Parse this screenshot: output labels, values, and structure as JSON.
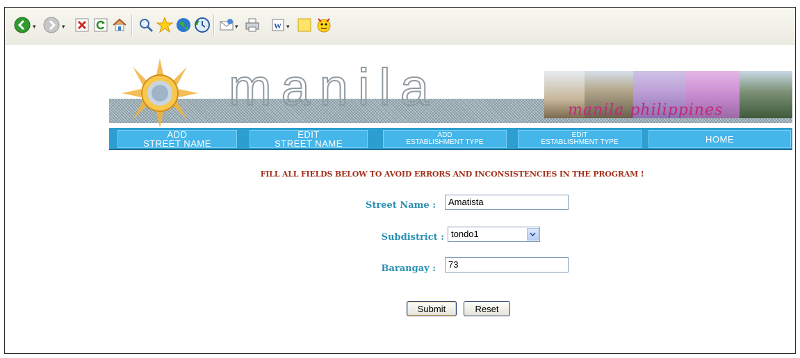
{
  "toolbar": {
    "icons": [
      "back-icon",
      "forward-icon",
      "stop-icon",
      "refresh-icon",
      "home-icon",
      "search-icon",
      "favorites-icon",
      "media-icon",
      "history-icon",
      "mail-icon",
      "print-icon",
      "edit-word-icon",
      "notes-icon",
      "messenger-icon"
    ]
  },
  "banner": {
    "title": "manila",
    "subtitle": "manila philippines"
  },
  "nav": {
    "add_street": [
      "ADD",
      "STREET NAME"
    ],
    "edit_street": [
      "EDIT",
      "STREET NAME"
    ],
    "add_establishment": [
      "ADD",
      "ESTABLISHMENT TYPE"
    ],
    "edit_establishment": [
      "EDIT",
      "ESTABLISHMENT TYPE"
    ],
    "home": "HOME"
  },
  "form": {
    "notice": "FILL ALL FIELDS BELOW TO AVOID ERRORS AND INCONSISTENCIES IN THE PROGRAM !",
    "street_label": "Street Name :",
    "street_value": "Amatista",
    "subdistrict_label": "Subdistrict :",
    "subdistrict_value": "tondo1",
    "barangay_label": "Barangay :",
    "barangay_value": "73",
    "submit_label": "Submit",
    "reset_label": "Reset"
  },
  "colors": {
    "nav_bar": "#2c9fd0",
    "nav_button": "#45b6ea",
    "notice_text": "#a3331f",
    "label_text": "#2a8fb2"
  }
}
